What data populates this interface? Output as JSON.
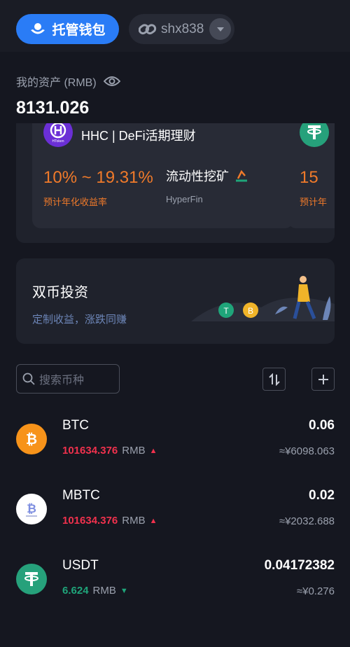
{
  "header": {
    "custody_label": "托管钱包",
    "account_name": "shx838",
    "accent_color": "#2a7cf6"
  },
  "assets": {
    "label": "我的资产 (RMB)",
    "total": "8131.026"
  },
  "promos": [
    {
      "icon": "hhc-logo-icon",
      "logo_text": "HToken",
      "title": "HHC | DeFi活期理财",
      "rate": "10% ~ 19.31%",
      "rate_label": "预计年化收益率",
      "type": "流动性挖矿",
      "provider": "HyperFin"
    },
    {
      "icon": "usdt-icon",
      "rate": "15",
      "rate_label": "预计年"
    }
  ],
  "dual": {
    "title": "双币投资",
    "subtitle": "定制收益，涨跌同赚"
  },
  "search": {
    "placeholder": "搜索币种"
  },
  "coins": [
    {
      "name": "BTC",
      "price": "101634.376",
      "unit": "RMB",
      "trend": "▲",
      "amount": "0.06",
      "value": "≈¥6098.063",
      "icon": "btc-icon",
      "color": "#f7931a"
    },
    {
      "name": "MBTC",
      "price": "101634.376",
      "unit": "RMB",
      "trend": "▲",
      "amount": "0.02",
      "value": "≈¥2032.688",
      "icon": "mbtc-icon",
      "color": "#ffffff"
    },
    {
      "name": "USDT",
      "price": "6.624",
      "unit": "RMB",
      "trend": "▼",
      "amount": "0.04172382",
      "value": "≈¥0.276",
      "icon": "usdt-icon",
      "color": "#26a17b"
    }
  ]
}
